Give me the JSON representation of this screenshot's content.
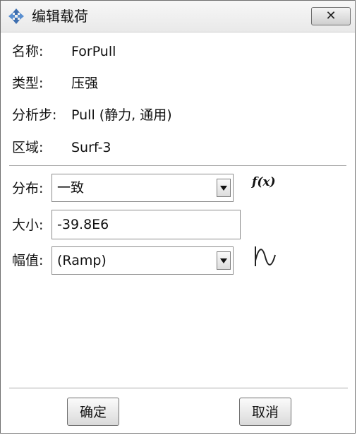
{
  "window": {
    "title": "编辑载荷",
    "close_label": "✕"
  },
  "info": {
    "name_label": "名称:",
    "name_value": "ForPull",
    "type_label": "类型:",
    "type_value": "压强",
    "step_label": "分析步:",
    "step_value": "Pull (静力, 通用)",
    "region_label": "区域:",
    "region_value": "Surf-3"
  },
  "fields": {
    "distribution_label": "分布:",
    "distribution_value": "一致",
    "function_icon_text": "f(x)",
    "magnitude_label": "大小:",
    "magnitude_value": "-39.8E6",
    "amplitude_label": "幅值:",
    "amplitude_value": "(Ramp)"
  },
  "buttons": {
    "ok_label": "确定",
    "cancel_label": "取消"
  },
  "icons": {
    "app": "move-cross-icon",
    "function": "function-fx-icon",
    "amplitude": "amplitude-wave-icon",
    "close": "close-icon",
    "dropdown": "chevron-down-icon"
  }
}
